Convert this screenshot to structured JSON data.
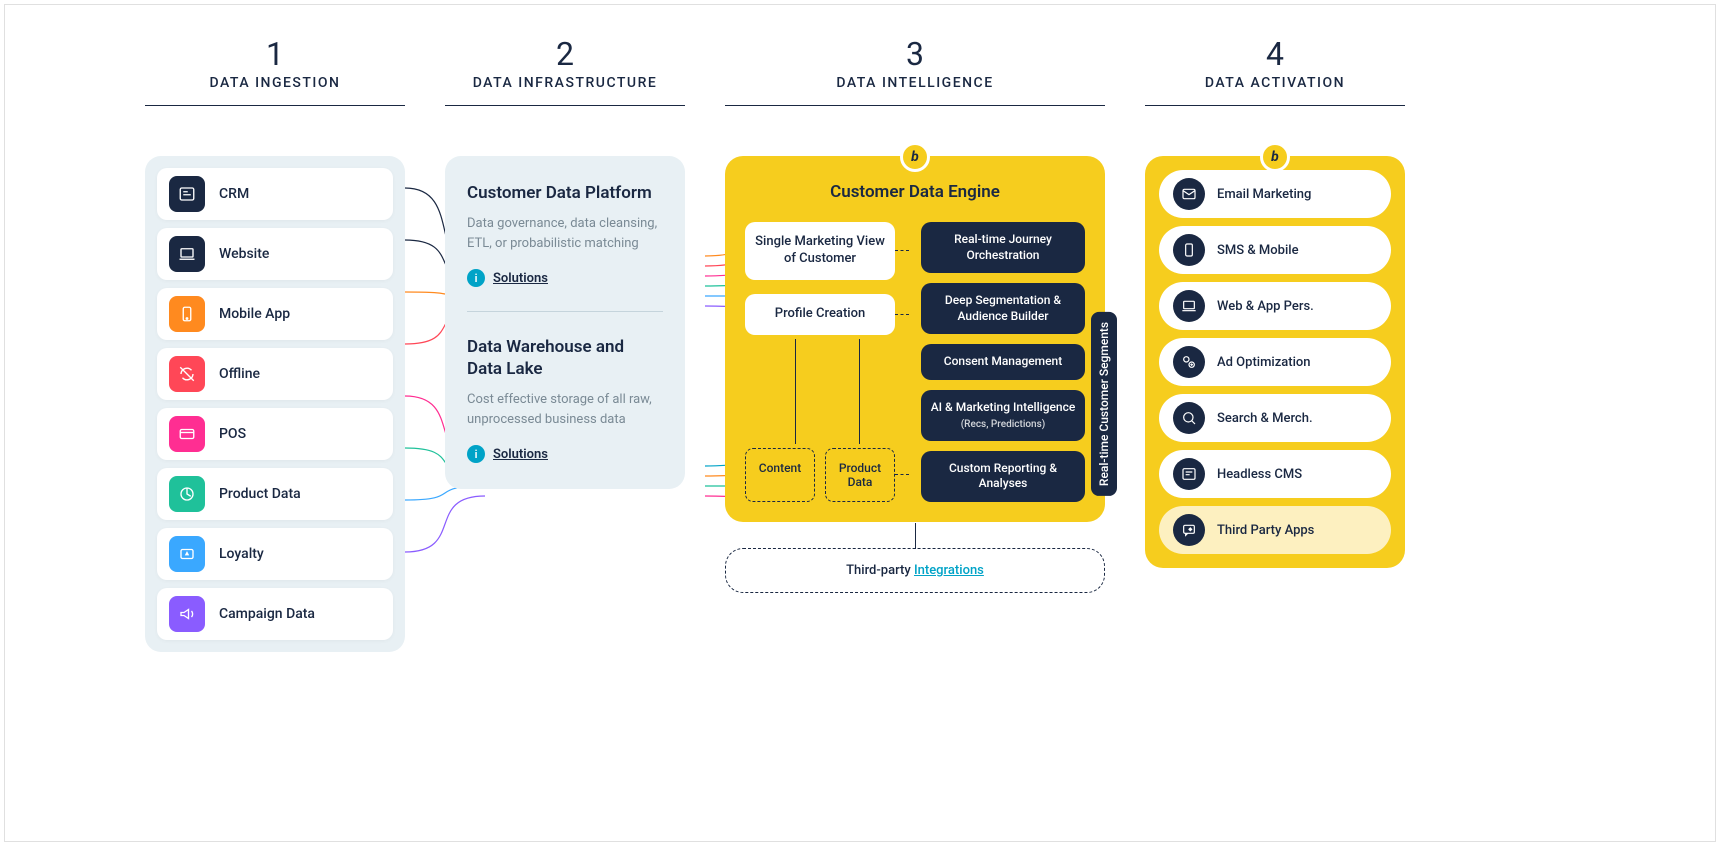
{
  "headers": [
    {
      "num": "1",
      "title": "DATA INGESTION"
    },
    {
      "num": "2",
      "title": "DATA INFRASTRUCTURE"
    },
    {
      "num": "3",
      "title": "DATA INTELLIGENCE"
    },
    {
      "num": "4",
      "title": "DATA ACTIVATION"
    }
  ],
  "ingestion": [
    {
      "label": "CRM",
      "icon": "crm",
      "color": "#1a2842"
    },
    {
      "label": "Website",
      "icon": "laptop",
      "color": "#1a2842"
    },
    {
      "label": "Mobile App",
      "icon": "mobile",
      "color": "#ff8a1f"
    },
    {
      "label": "Offline",
      "icon": "offline",
      "color": "#ff4757"
    },
    {
      "label": "POS",
      "icon": "card",
      "color": "#ff2e92"
    },
    {
      "label": "Product Data",
      "icon": "product",
      "color": "#1fc19a"
    },
    {
      "label": "Loyalty",
      "icon": "loyalty",
      "color": "#3aa8ff"
    },
    {
      "label": "Campaign Data",
      "icon": "speaker",
      "color": "#8a5cff"
    }
  ],
  "infra": {
    "cdp": {
      "title": "Customer Data Platform",
      "desc": "Data governance, data cleansing, ETL, or probabilistic matching",
      "link": "Solutions"
    },
    "dw": {
      "title": "Data Warehouse and Data Lake",
      "desc": "Cost effective storage of all raw, unprocessed business data",
      "link": "Solutions"
    }
  },
  "engine": {
    "title": "Customer Data Engine",
    "left": [
      "Single Marketing View of Customer",
      "Profile Creation"
    ],
    "content": "Content",
    "product": "Product Data",
    "right": [
      {
        "t": "Real-time Journey Orchestration"
      },
      {
        "t": "Deep Segmentation & Audience Builder"
      },
      {
        "t": "Consent Management"
      },
      {
        "t": "AI & Marketing Intelligence",
        "s": "(Recs, Predictions)"
      },
      {
        "t": "Custom Reporting & Analyses"
      }
    ],
    "integrations_prefix": "Third-party ",
    "integrations_link": "Integrations"
  },
  "segments_label": "Real-time Customer Segments",
  "activation": [
    {
      "label": "Email Marketing",
      "icon": "mail"
    },
    {
      "label": "SMS & Mobile",
      "icon": "phone"
    },
    {
      "label": "Web & App Pers.",
      "icon": "laptop2"
    },
    {
      "label": "Ad Optimization",
      "icon": "ad"
    },
    {
      "label": "Search & Merch.",
      "icon": "search"
    },
    {
      "label": "Headless CMS",
      "icon": "cms"
    },
    {
      "label": "Third Party Apps",
      "icon": "chat",
      "yellow": true
    }
  ],
  "flow_colors": [
    "#ff8a1f",
    "#ff4757",
    "#ff2e92",
    "#1fc19a",
    "#3aa8ff",
    "#8a5cff",
    "#00a3c7",
    "#f6cd1e"
  ]
}
